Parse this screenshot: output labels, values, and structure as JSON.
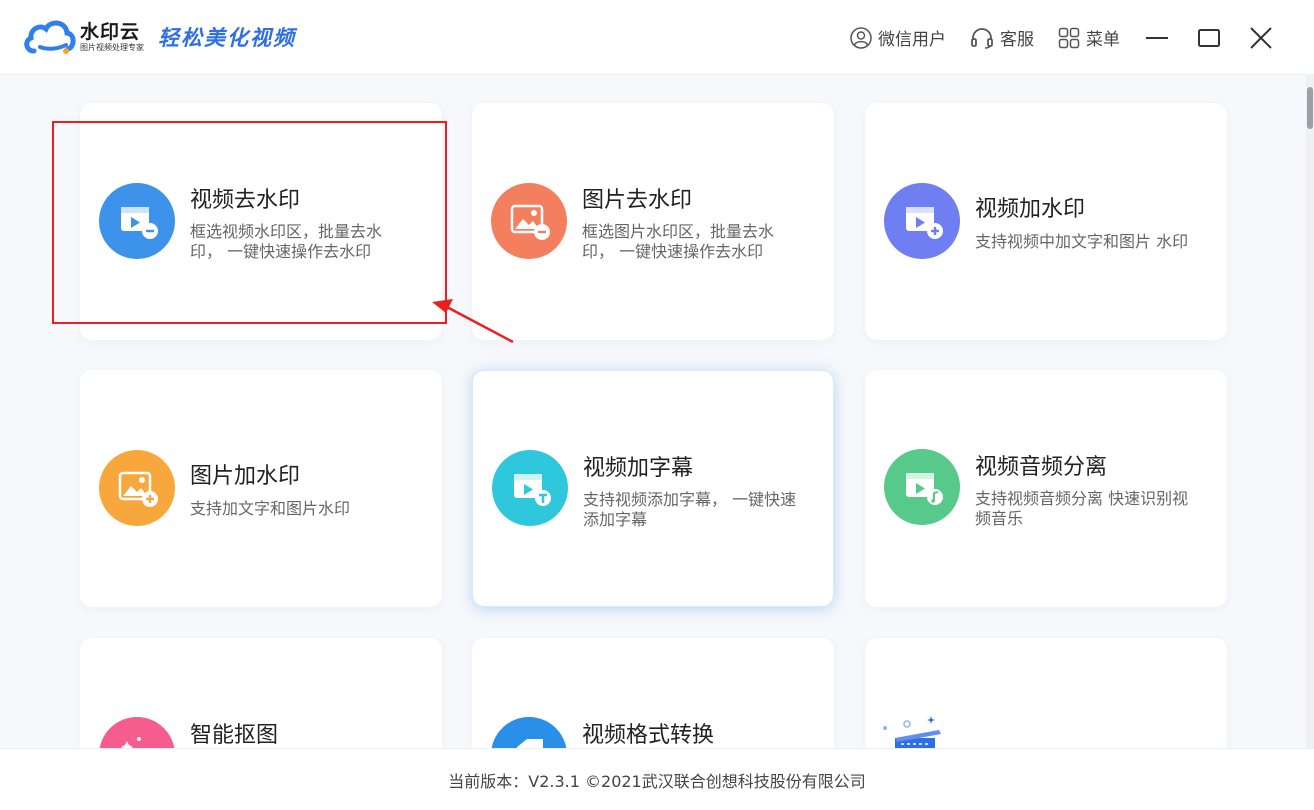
{
  "app": {
    "name": "水印云",
    "subtitle": "图片视频处理专家",
    "slogan": "轻松美化视频"
  },
  "topbar": {
    "user_label": "微信用户",
    "service_label": "客服",
    "menu_label": "菜单",
    "user_icon": "user-icon",
    "service_icon": "headset-icon",
    "menu_icon": "grid-menu-icon"
  },
  "tools": [
    {
      "title": "视频去水印",
      "desc_line1": "框选视频水印区，批量去水",
      "desc_line2": "印， 一键快速操作去水印",
      "icon": "video-remove-icon",
      "color": "#3d93ea"
    },
    {
      "title": "图片去水印",
      "desc_line1": "框选图片水印区，批量去水",
      "desc_line2": "印， 一键快速操作去水印",
      "icon": "image-remove-icon",
      "color": "#f47f5e"
    },
    {
      "title": "视频加水印",
      "desc_line1": "支持视频中加文字和图片 水印",
      "desc_line2": "",
      "icon": "video-add-icon",
      "color": "#6f7ef0"
    },
    {
      "title": "图片加水印",
      "desc_line1": "支持加文字和图片水印",
      "desc_line2": "",
      "icon": "image-add-icon",
      "color": "#f8a73c"
    },
    {
      "title": "视频加字幕",
      "desc_line1": "支持视频添加字幕， 一键快速",
      "desc_line2": "添加字幕",
      "icon": "video-subtitle-icon",
      "color": "#2fc7dc"
    },
    {
      "title": "视频音频分离",
      "desc_line1": "支持视频音频分离 快速识别视",
      "desc_line2": "频音乐",
      "icon": "video-audio-split-icon",
      "color": "#57c98a"
    },
    {
      "title": "智能抠图",
      "icon": "smart-cutout-icon",
      "color": "#f45d8e"
    },
    {
      "title": "视频格式转换",
      "icon": "video-convert-icon",
      "color": "#2a8fe8"
    }
  ],
  "footer": {
    "text": "当前版本：V2.3.1 ©2021武汉联合创想科技股份有限公司"
  }
}
